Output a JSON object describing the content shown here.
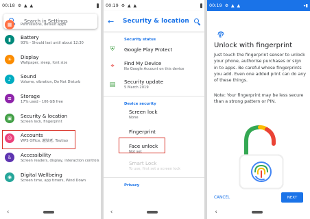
{
  "panel1": {
    "status": {
      "time": "00:18",
      "icons": "⚙ ▲ ▲"
    },
    "search": {
      "placeholder": "Search in Settings"
    },
    "partial_item": {
      "sub": "Permissions, default apps",
      "color": "#ff7043"
    },
    "items": [
      {
        "title": "Battery",
        "sub": "93% - Should last until about 12:30",
        "color": "#00897b",
        "glyph": "▮"
      },
      {
        "title": "Display",
        "sub": "Wallpaper, sleep, font size",
        "color": "#fb8c00",
        "glyph": "☀"
      },
      {
        "title": "Sound",
        "sub": "Volume, vibration, Do Not Disturb",
        "color": "#00acc1",
        "glyph": "♪"
      },
      {
        "title": "Storage",
        "sub": "17% used - 106 GB free",
        "color": "#8e24aa",
        "glyph": "≡"
      },
      {
        "title": "Security & location",
        "sub": "Screen lock, fingerprint",
        "color": "#43a047",
        "glyph": "▣"
      },
      {
        "title": "Accounts",
        "sub": "WPS Office, 越狱老, Toutiao",
        "color": "#ec407a",
        "glyph": "☺"
      },
      {
        "title": "Accessibility",
        "sub": "Screen readers, display, interaction controls",
        "color": "#5e35b1",
        "glyph": "♿"
      },
      {
        "title": "Digital Wellbeing",
        "sub": "Screen time, app timers, Wind Down",
        "color": "#26a69a",
        "glyph": "◉"
      }
    ]
  },
  "panel2": {
    "status": {
      "time": "00:19",
      "icons": "⚙ ▲ ▲"
    },
    "title": "Security & location",
    "sections": {
      "status": "Security status",
      "device": "Device security",
      "privacy": "Privacy"
    },
    "status_items": [
      {
        "title": "Google Play Protect",
        "sub": "",
        "icon_color": "#43a047",
        "glyph": "⛨"
      },
      {
        "title": "Find My Device",
        "sub": "No Google Account on this device",
        "icon_color": "#e53935",
        "glyph": "⌖"
      },
      {
        "title": "Security update",
        "sub": "5 March 2019",
        "icon_color": "#43a047",
        "glyph": "▤"
      }
    ],
    "device_items": [
      {
        "title": "Screen lock",
        "sub": "None"
      },
      {
        "title": "Fingerprint",
        "sub": ""
      },
      {
        "title": "Face unlock",
        "sub": "Not set"
      },
      {
        "title": "Smart Lock",
        "sub": "To use, first set a screen lock"
      }
    ]
  },
  "panel3": {
    "status": {
      "time": "00:19",
      "icons": "⚙ ▲ ▲"
    },
    "title": "Unlock with fingerprint",
    "body": "Just touch the fingerprint sensor to unlock your phone, authorise purchases or sign in to apps. Be careful whose fingerprints you add. Even one added print can do any of these things.",
    "note": "Note: Your fingerprint may be less secure than a strong pattern or PIN.",
    "cancel": "CANCEL",
    "next": "NEXT"
  },
  "colors": {
    "accent": "#1a73e8",
    "highlight": "#d93025"
  }
}
